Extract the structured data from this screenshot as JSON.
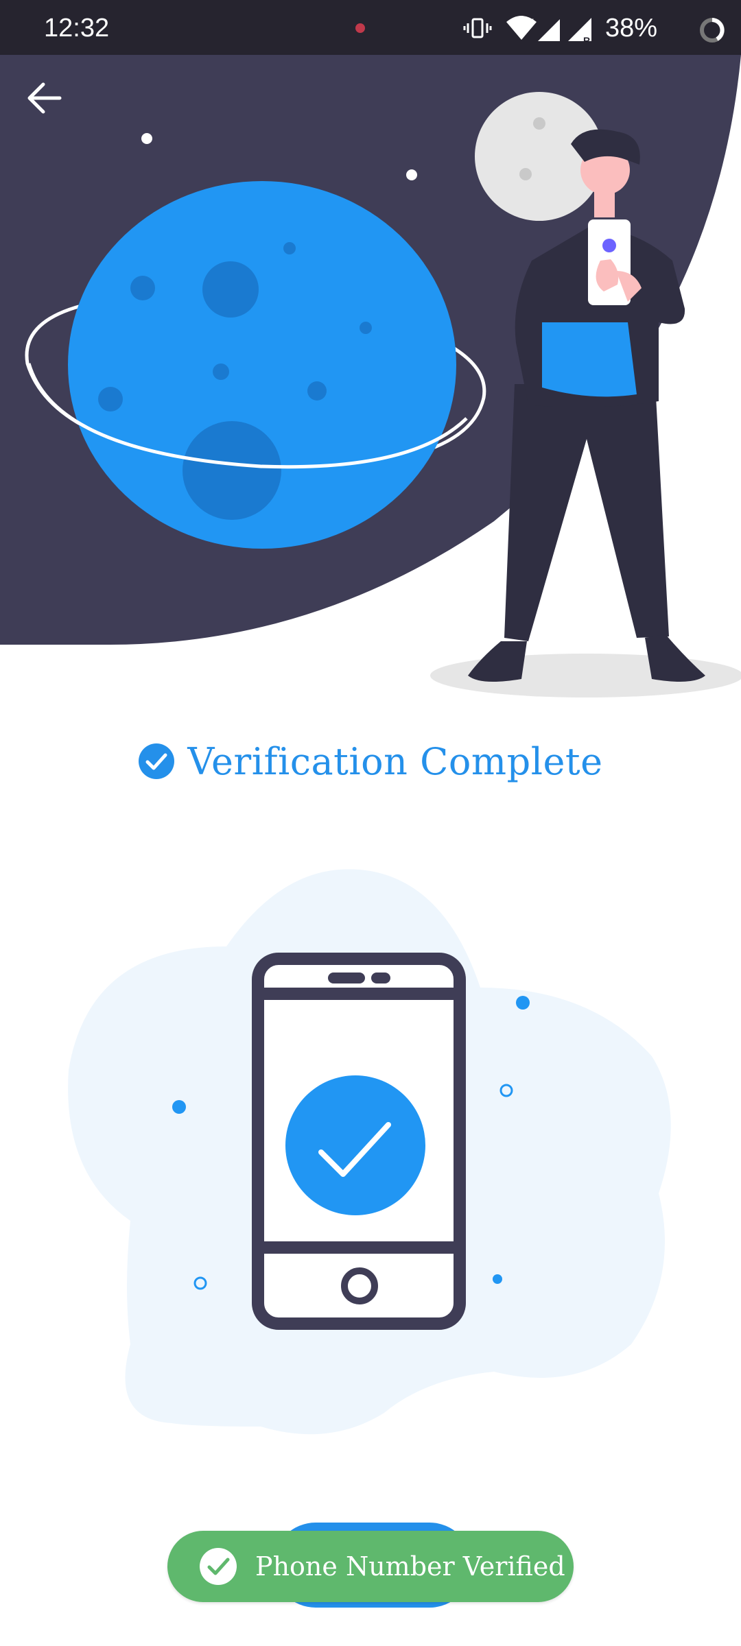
{
  "status_bar": {
    "time": "12:32",
    "battery": "38%",
    "icons": [
      "vibrate-icon",
      "wifi-icon",
      "signal-icon",
      "signal-roaming-icon",
      "battery-icon"
    ]
  },
  "header": {
    "back_icon": "arrow-left-icon"
  },
  "main": {
    "title": "Verification Complete",
    "title_icon": "check-circle-icon"
  },
  "toast": {
    "message": "Phone Number Verified",
    "icon": "check-circle-icon"
  },
  "colors": {
    "accent": "#2490ea",
    "dark": "#3f3d56",
    "toast_green": "#5fb86d",
    "status_bar": "#26242f"
  }
}
